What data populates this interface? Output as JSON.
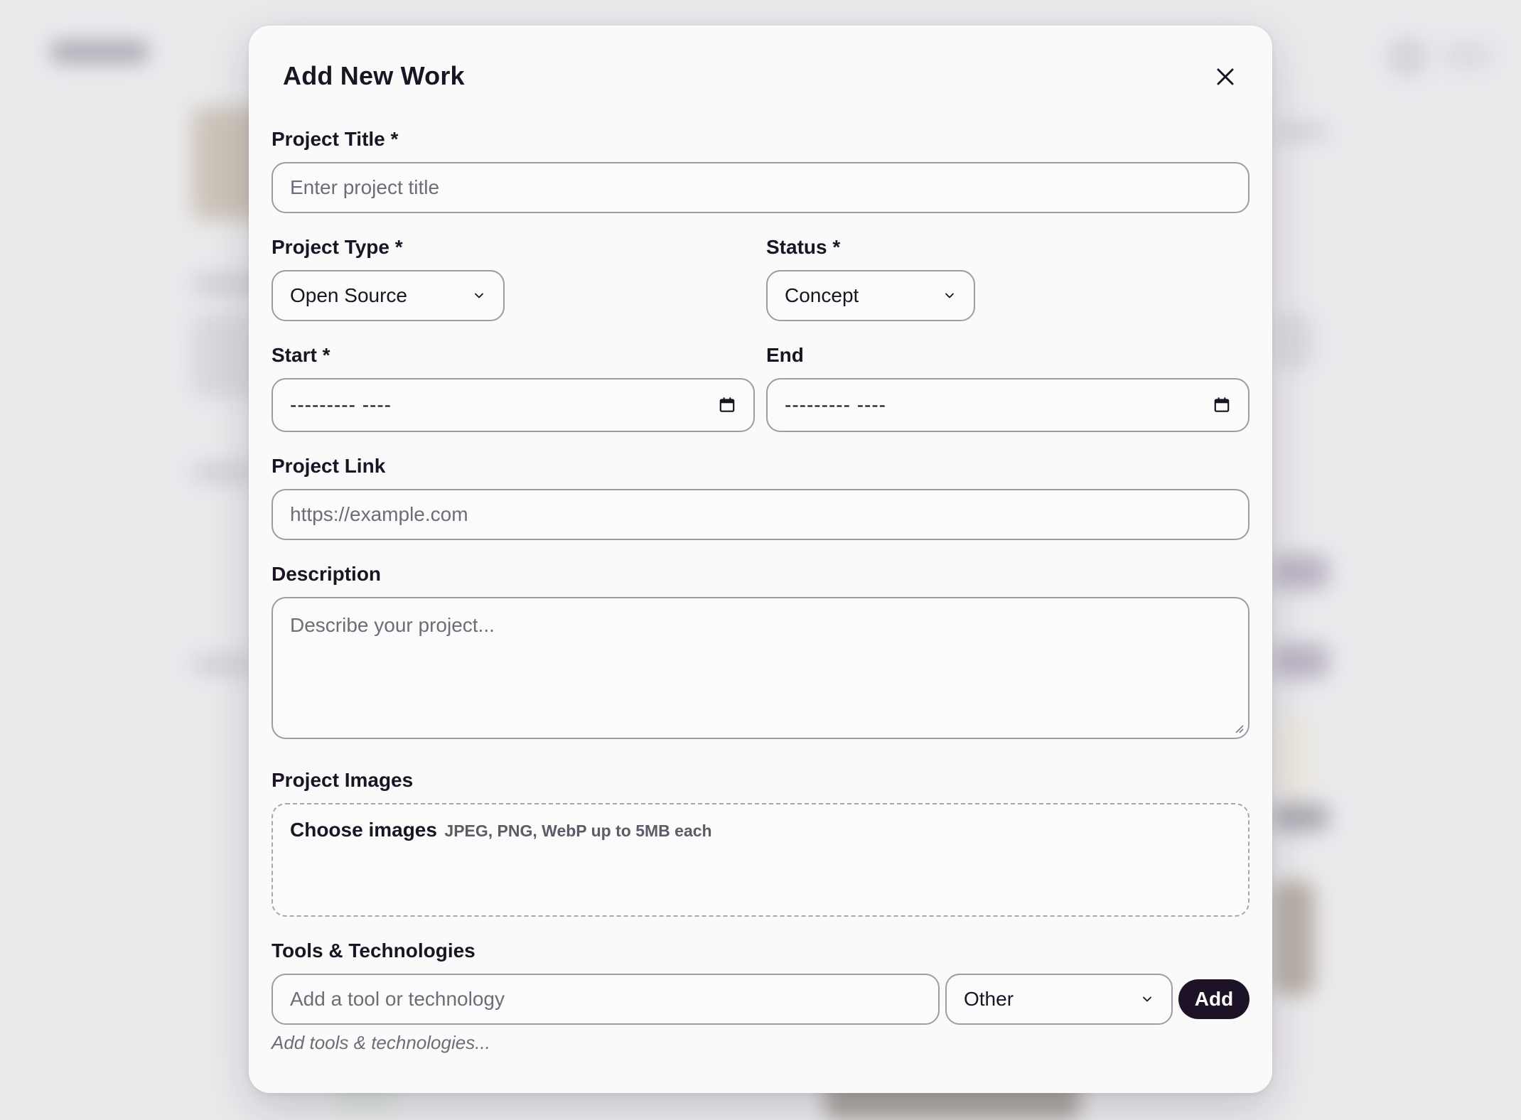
{
  "modal": {
    "title": "Add New Work",
    "close_icon": "close-icon"
  },
  "form": {
    "project_title": {
      "label": "Project Title *",
      "placeholder": "Enter project title",
      "value": ""
    },
    "project_type": {
      "label": "Project Type *",
      "selected": "Open Source"
    },
    "status": {
      "label": "Status *",
      "selected": "Concept"
    },
    "start": {
      "label": "Start *",
      "display": "--------- ----",
      "icon": "calendar-icon"
    },
    "end": {
      "label": "End",
      "display": "--------- ----",
      "icon": "calendar-icon"
    },
    "project_link": {
      "label": "Project Link",
      "placeholder": "https://example.com",
      "value": ""
    },
    "description": {
      "label": "Description",
      "placeholder": "Describe your project...",
      "value": ""
    },
    "project_images": {
      "label": "Project Images",
      "choose_label": "Choose images",
      "hint": "JPEG, PNG, WebP up to 5MB each"
    },
    "tools": {
      "label": "Tools & Technologies",
      "input_placeholder": "Add a tool or technology",
      "category_selected": "Other",
      "add_label": "Add",
      "empty_hint": "Add tools & technologies..."
    }
  },
  "colors": {
    "primary": "#1e1326",
    "border": "#9f9aa6",
    "placeholder": "#6f6b77",
    "modal_bg": "#fafafb"
  }
}
